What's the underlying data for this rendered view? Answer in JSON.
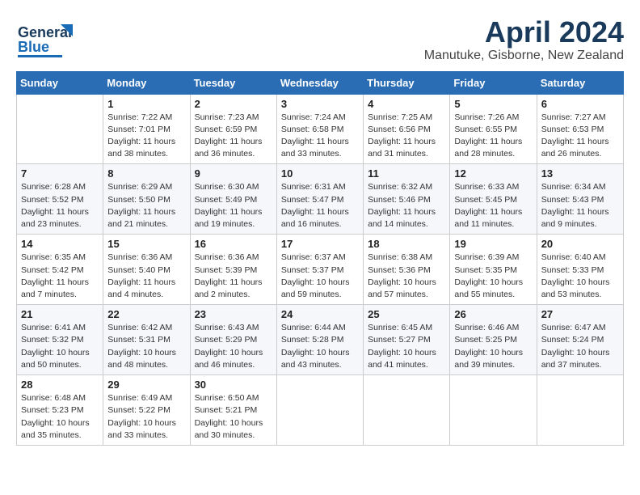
{
  "header": {
    "logo": {
      "general": "General",
      "blue": "Blue"
    },
    "title": "April 2024",
    "location": "Manutuke, Gisborne, New Zealand"
  },
  "weekdays": [
    "Sunday",
    "Monday",
    "Tuesday",
    "Wednesday",
    "Thursday",
    "Friday",
    "Saturday"
  ],
  "weeks": [
    [
      {
        "day": "",
        "info": ""
      },
      {
        "day": "1",
        "info": "Sunrise: 7:22 AM\nSunset: 7:01 PM\nDaylight: 11 hours\nand 38 minutes."
      },
      {
        "day": "2",
        "info": "Sunrise: 7:23 AM\nSunset: 6:59 PM\nDaylight: 11 hours\nand 36 minutes."
      },
      {
        "day": "3",
        "info": "Sunrise: 7:24 AM\nSunset: 6:58 PM\nDaylight: 11 hours\nand 33 minutes."
      },
      {
        "day": "4",
        "info": "Sunrise: 7:25 AM\nSunset: 6:56 PM\nDaylight: 11 hours\nand 31 minutes."
      },
      {
        "day": "5",
        "info": "Sunrise: 7:26 AM\nSunset: 6:55 PM\nDaylight: 11 hours\nand 28 minutes."
      },
      {
        "day": "6",
        "info": "Sunrise: 7:27 AM\nSunset: 6:53 PM\nDaylight: 11 hours\nand 26 minutes."
      }
    ],
    [
      {
        "day": "7",
        "info": "Sunrise: 6:28 AM\nSunset: 5:52 PM\nDaylight: 11 hours\nand 23 minutes."
      },
      {
        "day": "8",
        "info": "Sunrise: 6:29 AM\nSunset: 5:50 PM\nDaylight: 11 hours\nand 21 minutes."
      },
      {
        "day": "9",
        "info": "Sunrise: 6:30 AM\nSunset: 5:49 PM\nDaylight: 11 hours\nand 19 minutes."
      },
      {
        "day": "10",
        "info": "Sunrise: 6:31 AM\nSunset: 5:47 PM\nDaylight: 11 hours\nand 16 minutes."
      },
      {
        "day": "11",
        "info": "Sunrise: 6:32 AM\nSunset: 5:46 PM\nDaylight: 11 hours\nand 14 minutes."
      },
      {
        "day": "12",
        "info": "Sunrise: 6:33 AM\nSunset: 5:45 PM\nDaylight: 11 hours\nand 11 minutes."
      },
      {
        "day": "13",
        "info": "Sunrise: 6:34 AM\nSunset: 5:43 PM\nDaylight: 11 hours\nand 9 minutes."
      }
    ],
    [
      {
        "day": "14",
        "info": "Sunrise: 6:35 AM\nSunset: 5:42 PM\nDaylight: 11 hours\nand 7 minutes."
      },
      {
        "day": "15",
        "info": "Sunrise: 6:36 AM\nSunset: 5:40 PM\nDaylight: 11 hours\nand 4 minutes."
      },
      {
        "day": "16",
        "info": "Sunrise: 6:36 AM\nSunset: 5:39 PM\nDaylight: 11 hours\nand 2 minutes."
      },
      {
        "day": "17",
        "info": "Sunrise: 6:37 AM\nSunset: 5:37 PM\nDaylight: 10 hours\nand 59 minutes."
      },
      {
        "day": "18",
        "info": "Sunrise: 6:38 AM\nSunset: 5:36 PM\nDaylight: 10 hours\nand 57 minutes."
      },
      {
        "day": "19",
        "info": "Sunrise: 6:39 AM\nSunset: 5:35 PM\nDaylight: 10 hours\nand 55 minutes."
      },
      {
        "day": "20",
        "info": "Sunrise: 6:40 AM\nSunset: 5:33 PM\nDaylight: 10 hours\nand 53 minutes."
      }
    ],
    [
      {
        "day": "21",
        "info": "Sunrise: 6:41 AM\nSunset: 5:32 PM\nDaylight: 10 hours\nand 50 minutes."
      },
      {
        "day": "22",
        "info": "Sunrise: 6:42 AM\nSunset: 5:31 PM\nDaylight: 10 hours\nand 48 minutes."
      },
      {
        "day": "23",
        "info": "Sunrise: 6:43 AM\nSunset: 5:29 PM\nDaylight: 10 hours\nand 46 minutes."
      },
      {
        "day": "24",
        "info": "Sunrise: 6:44 AM\nSunset: 5:28 PM\nDaylight: 10 hours\nand 43 minutes."
      },
      {
        "day": "25",
        "info": "Sunrise: 6:45 AM\nSunset: 5:27 PM\nDaylight: 10 hours\nand 41 minutes."
      },
      {
        "day": "26",
        "info": "Sunrise: 6:46 AM\nSunset: 5:25 PM\nDaylight: 10 hours\nand 39 minutes."
      },
      {
        "day": "27",
        "info": "Sunrise: 6:47 AM\nSunset: 5:24 PM\nDaylight: 10 hours\nand 37 minutes."
      }
    ],
    [
      {
        "day": "28",
        "info": "Sunrise: 6:48 AM\nSunset: 5:23 PM\nDaylight: 10 hours\nand 35 minutes."
      },
      {
        "day": "29",
        "info": "Sunrise: 6:49 AM\nSunset: 5:22 PM\nDaylight: 10 hours\nand 33 minutes."
      },
      {
        "day": "30",
        "info": "Sunrise: 6:50 AM\nSunset: 5:21 PM\nDaylight: 10 hours\nand 30 minutes."
      },
      {
        "day": "",
        "info": ""
      },
      {
        "day": "",
        "info": ""
      },
      {
        "day": "",
        "info": ""
      },
      {
        "day": "",
        "info": ""
      }
    ]
  ]
}
